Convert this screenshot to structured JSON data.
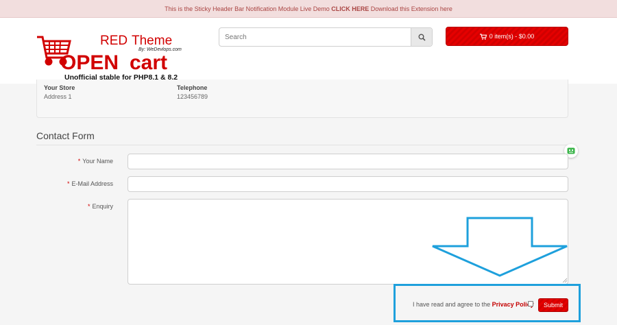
{
  "notification_bar": {
    "text_before": "This is the Sticky Header Bar Notification Module Live Demo ",
    "link_text": "CLICK HERE",
    "text_after": " Download this Extension here"
  },
  "logo": {
    "red": "RED",
    "theme": "Theme",
    "by": "By: WeDevlops.com",
    "open": "OPEN",
    "cart": "cart",
    "tagline": "Unofficial stable for PHP8.1 & 8.2"
  },
  "search": {
    "placeholder": "Search"
  },
  "cart": {
    "label": "0 item(s) - $0.00"
  },
  "store": {
    "name_heading": "Your Store",
    "address": "Address 1",
    "phone_heading": "Telephone",
    "phone": "123456789"
  },
  "contact_form": {
    "legend": "Contact Form",
    "required_marker": "*",
    "name_label": "Your Name",
    "email_label": "E-Mail Address",
    "enquiry_label": "Enquiry",
    "name_value": "",
    "email_value": "",
    "enquiry_value": ""
  },
  "agreement": {
    "text": "I have read and agree to the ",
    "link": "Privacy Policy",
    "checked": false
  },
  "submit": {
    "label": "Submit"
  },
  "colors": {
    "accent": "#d10000",
    "notification_bg": "#f2dede",
    "highlight": "#1ea0dc"
  }
}
